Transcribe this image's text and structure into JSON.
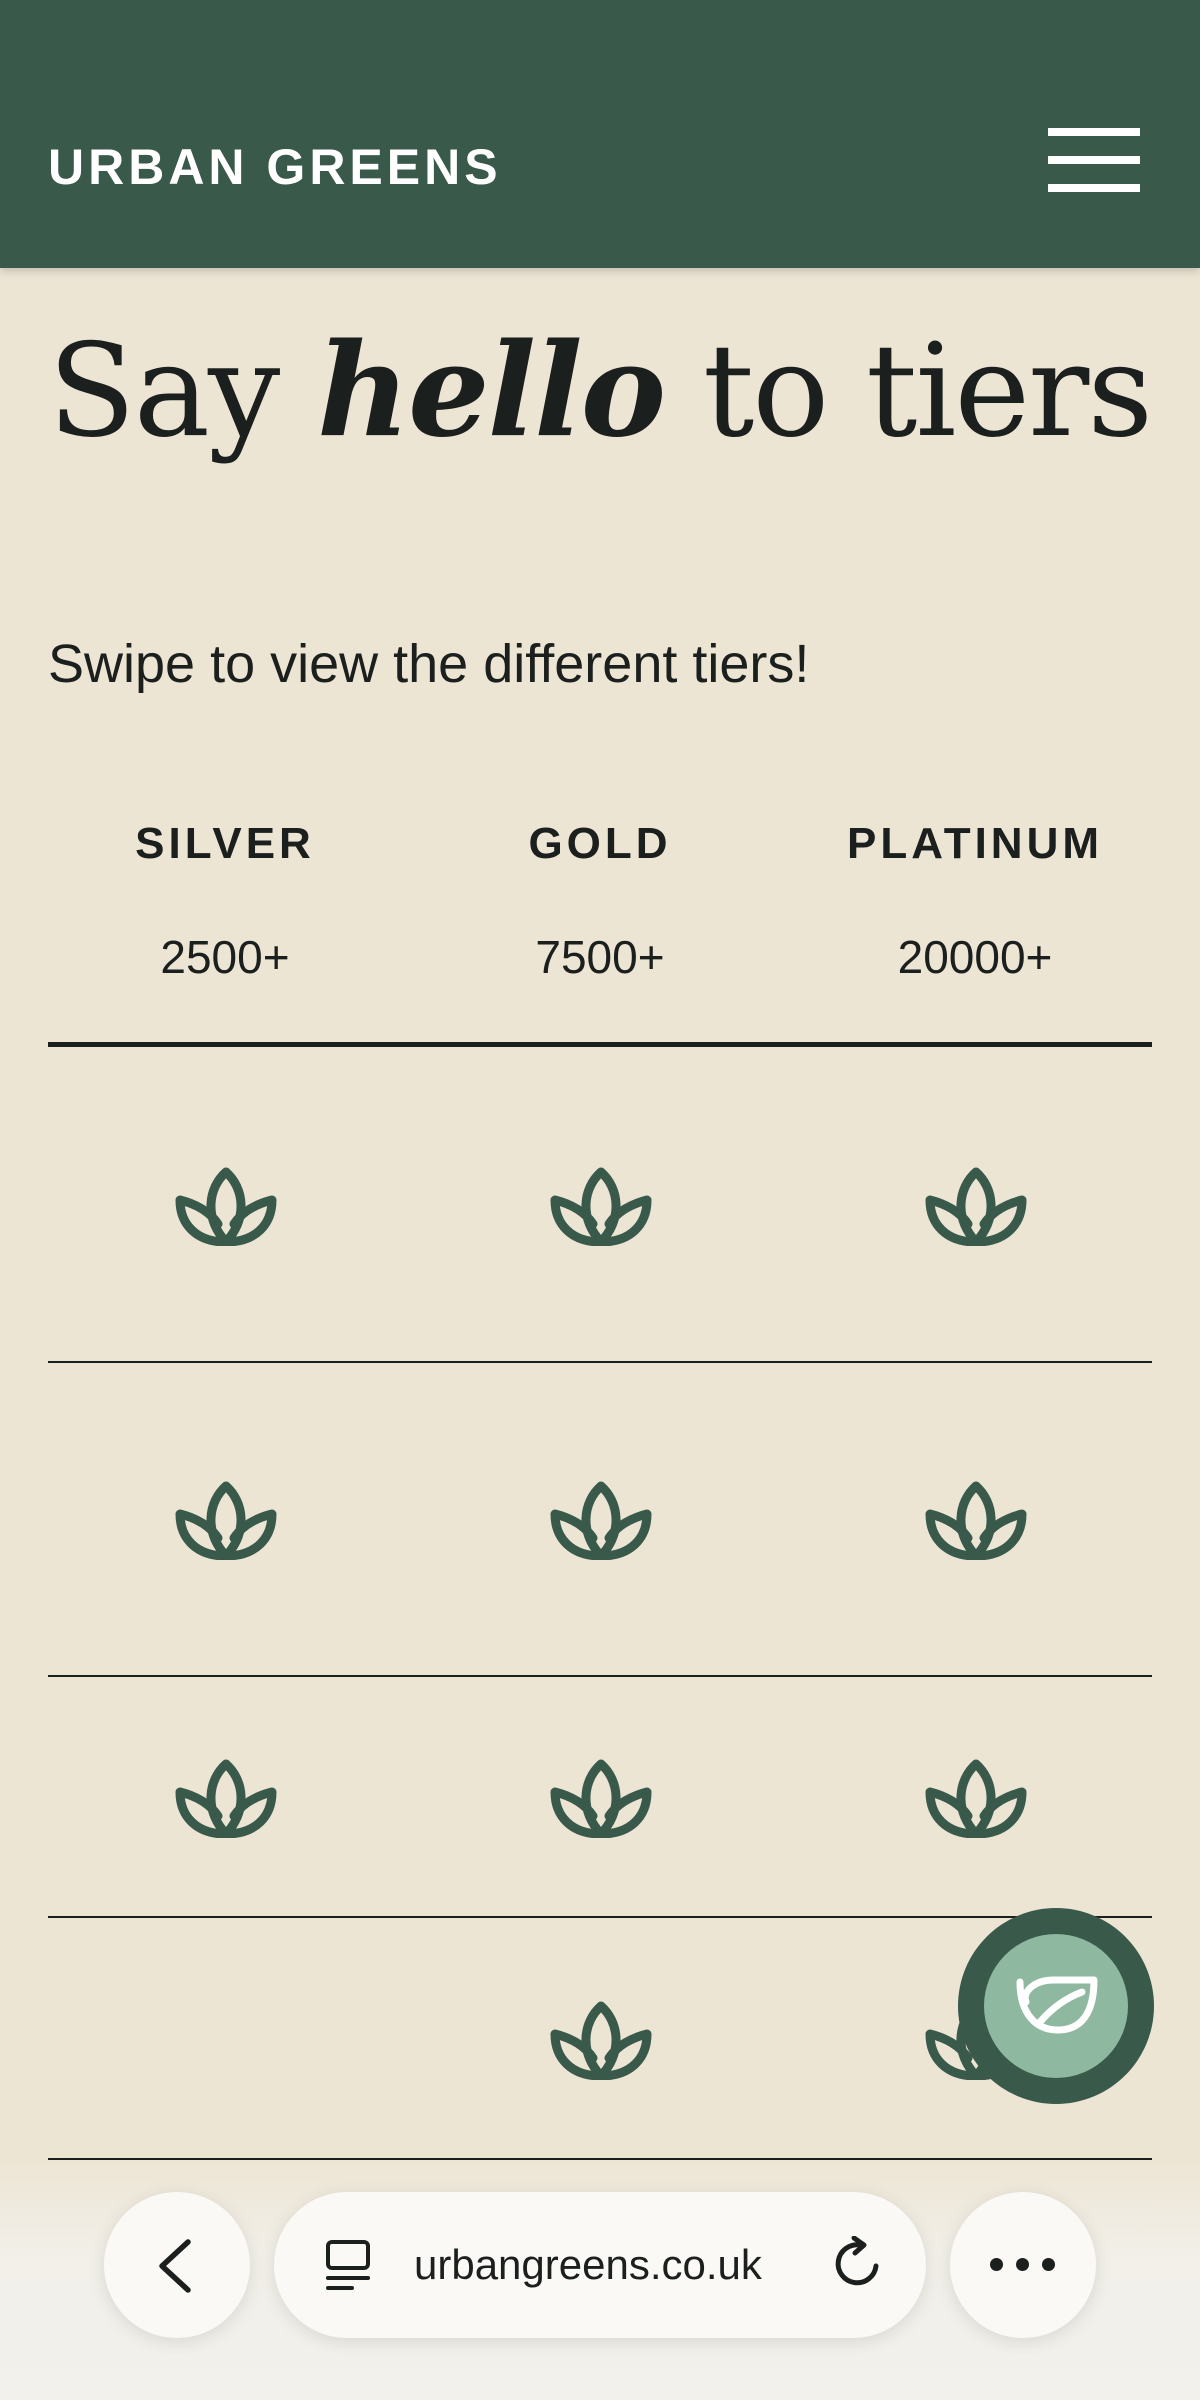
{
  "header": {
    "brand": "URBAN GREENS",
    "menu_icon": "hamburger-menu-icon",
    "background_color": "#39594b"
  },
  "hero": {
    "title_before": "Say ",
    "title_emphasis": "hello",
    "title_after": " to tiers",
    "subtitle": "Swipe to view the different tiers!"
  },
  "tiers": [
    {
      "name": "SILVER",
      "points": "2500+"
    },
    {
      "name": "GOLD",
      "points": "7500+"
    },
    {
      "name": "PLATINUM",
      "points": "20000+"
    }
  ],
  "benefit_rows": [
    {
      "silver": true,
      "gold": true,
      "platinum": true
    },
    {
      "silver": true,
      "gold": true,
      "platinum": true
    },
    {
      "silver": true,
      "gold": true,
      "platinum": true
    },
    {
      "silver": false,
      "gold": true,
      "platinum": true
    }
  ],
  "benefit_icon": "lotus-icon",
  "fab": {
    "icon": "leaf-icon",
    "outer_color": "#39594b",
    "inner_color": "#8fb8a0"
  },
  "browser": {
    "url": "urbangreens.co.uk",
    "back_icon": "chevron-left-icon",
    "page_icon": "page-menu-icon",
    "reload_icon": "reload-icon",
    "more_icon": "more-dots-icon"
  },
  "colors": {
    "background": "#ede5d4",
    "accent": "#39594b",
    "text": "#1b1f1d"
  }
}
